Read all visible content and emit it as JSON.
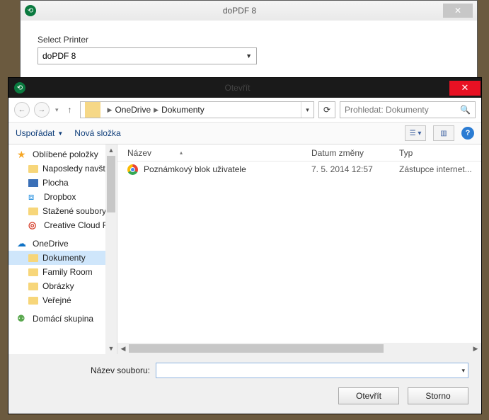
{
  "pdf_window": {
    "title": "doPDF 8",
    "select_printer_label": "Select Printer",
    "selected_printer": "doPDF 8"
  },
  "dialog": {
    "title": "Otevřít",
    "breadcrumb": {
      "part1": "OneDrive",
      "part2": "Dokumenty"
    },
    "search_placeholder": "Prohledat: Dokumenty",
    "toolbar": {
      "organize": "Uspořádat",
      "new_folder": "Nová složka"
    },
    "columns": {
      "name": "Název",
      "date": "Datum změny",
      "type": "Typ"
    },
    "tree": {
      "favorites": "Oblíbené položky",
      "recent": "Naposledy navšt",
      "desktop": "Plocha",
      "dropbox": "Dropbox",
      "downloads": "Stažené soubory",
      "cc": "Creative Cloud Fi",
      "onedrive": "OneDrive",
      "documents": "Dokumenty",
      "family": "Family Room",
      "pictures": "Obrázky",
      "public": "Veřejné",
      "homegroup": "Domácí skupina"
    },
    "rows": [
      {
        "name": "Poznámkový blok uživatele",
        "date": "7. 5. 2014 12:57",
        "type": "Zástupce internet..."
      }
    ],
    "filename_label": "Název souboru:",
    "filename_value": "",
    "buttons": {
      "open": "Otevřít",
      "cancel": "Storno"
    }
  }
}
